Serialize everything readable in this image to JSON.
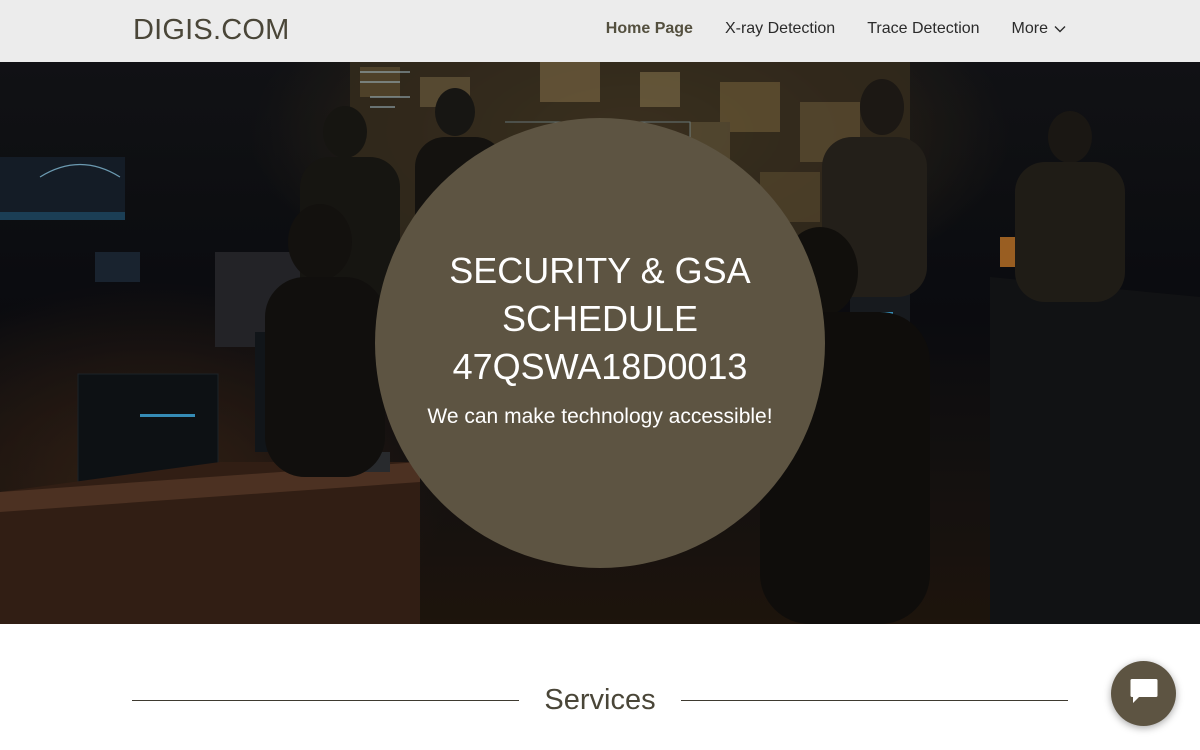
{
  "header": {
    "logo": "DIGIS.COM",
    "nav": [
      {
        "label": "Home Page",
        "active": true
      },
      {
        "label": "X-ray Detection",
        "active": false
      },
      {
        "label": "Trace Detection",
        "active": false
      },
      {
        "label": "More",
        "active": false,
        "icon": "chevron-down-icon"
      }
    ]
  },
  "hero": {
    "title": "SECURITY & GSA SCHEDULE 47QSWA18D0013",
    "subtitle": "We can make technology accessible!"
  },
  "services": {
    "heading": "Services"
  },
  "chat": {
    "icon": "chat-bubble-icon"
  },
  "colors": {
    "accent": "#5d5442",
    "navbar": "#ececec",
    "logo": "#4a4638"
  }
}
